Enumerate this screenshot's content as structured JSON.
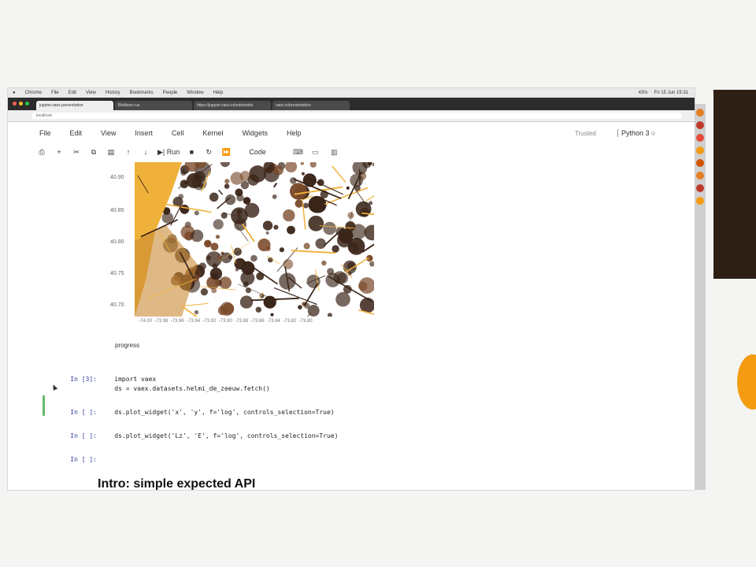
{
  "menubar": {
    "items": [
      "Chrome",
      "File",
      "Edit",
      "View",
      "History",
      "Bookmarks",
      "People",
      "Window",
      "Help"
    ],
    "status": [
      "43%",
      "Fri 15 Jun 15:31"
    ]
  },
  "tabs": [
    {
      "label": "jupyter.vaex.presentation",
      "active": true
    },
    {
      "label": "Blobless run",
      "active": false
    },
    {
      "label": "https://jupyter.vaex.io/notebooks",
      "active": false
    },
    {
      "label": "vaex.io/presentation",
      "active": false
    }
  ],
  "address": "localhost",
  "jupyter_menu": [
    "File",
    "Edit",
    "View",
    "Insert",
    "Cell",
    "Kernel",
    "Widgets",
    "Help"
  ],
  "trusted": "Trusted",
  "kernel_name": "Python 3",
  "toolbar": {
    "run_label": "Run",
    "cell_type": "Code"
  },
  "plot": {
    "y_ticks": [
      "40.90",
      "40.85",
      "40.80",
      "40.75",
      "40.70"
    ],
    "x_ticks": [
      "-74.00",
      "-73.98",
      "-73.96",
      "-73.94",
      "-73.92",
      "-73.90",
      "-73.88",
      "-73.86",
      "-73.84",
      "-73.82",
      "-73.80"
    ],
    "colors": {
      "bright": "#f0b13a",
      "dark": "#3a2418",
      "mid": "#7a4a2a"
    }
  },
  "progress_label": "progress",
  "cells": [
    {
      "prompt": "In [3]:",
      "lines": [
        "import vaex",
        "ds = vaex.datasets.helmi_de_zeeuw.fetch()"
      ]
    },
    {
      "prompt": "In [ ]:",
      "lines": [
        "ds.plot_widget('x', 'y', f='log', controls_selection=True)"
      ]
    },
    {
      "prompt": "In [ ]:",
      "lines": [
        "ds.plot_widget('Lz', 'E', f='log', controls_selection=True)"
      ]
    },
    {
      "prompt": "In [ ]:",
      "lines": [
        ""
      ]
    }
  ],
  "heading": "Intro: simple expected API"
}
